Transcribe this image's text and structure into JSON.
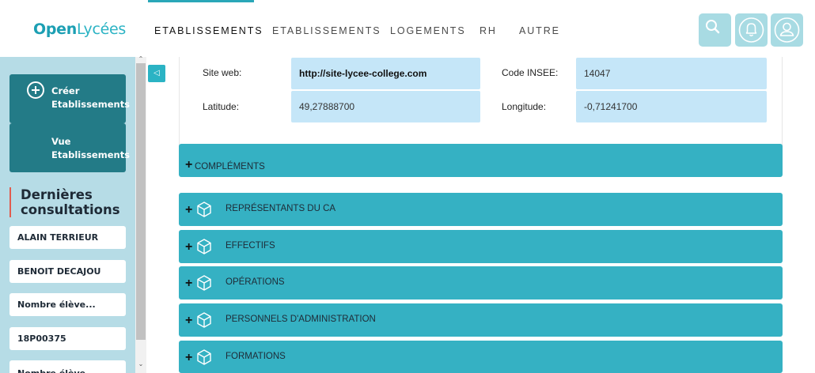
{
  "header": {
    "logo_strong": "Open",
    "logo_rest": "Lycées",
    "nav": [
      {
        "label": "ETABLISSEMENTS"
      },
      {
        "label": "ETABLISSEMENTS"
      },
      {
        "label": "LOGEMENTS"
      },
      {
        "label": "RH"
      },
      {
        "label": "AUTRE"
      }
    ],
    "icons": [
      "search-icon",
      "bell-icon",
      "user-icon"
    ],
    "accent_color": "#2bb3c4"
  },
  "sidebar": {
    "buttons": [
      {
        "line1": "Créer",
        "line2": "Etablissements"
      },
      {
        "line1": "Vue",
        "line2": "Etablissements"
      }
    ],
    "recent_title_line1": "Dernières",
    "recent_title_line2": "consultations",
    "recent_items": [
      {
        "label": "ALAIN TERRIEUR"
      },
      {
        "label": "BENOIT DECAJOU"
      },
      {
        "label": "Nombre élève..."
      },
      {
        "label": "18P00375"
      },
      {
        "label": "Nombre élève..."
      }
    ]
  },
  "details": {
    "site_web_label": "Site web:",
    "site_web_value": "http://site-lycee-college.com",
    "code_insee_label": "Code INSEE:",
    "code_insee_value": "14047",
    "latitude_label": "Latitude:",
    "latitude_value": "49,27888700",
    "longitude_label": "Longitude:",
    "longitude_value": "-0,71241700"
  },
  "sections": {
    "complements": "COMPLÉMENTS",
    "items": [
      {
        "label": "REPRÉSENTANTS DU CA"
      },
      {
        "label": "EFFECTIFS"
      },
      {
        "label": "OPÉRATIONS"
      },
      {
        "label": "PERSONNELS D'ADMINISTRATION"
      },
      {
        "label": "FORMATIONS"
      }
    ]
  }
}
